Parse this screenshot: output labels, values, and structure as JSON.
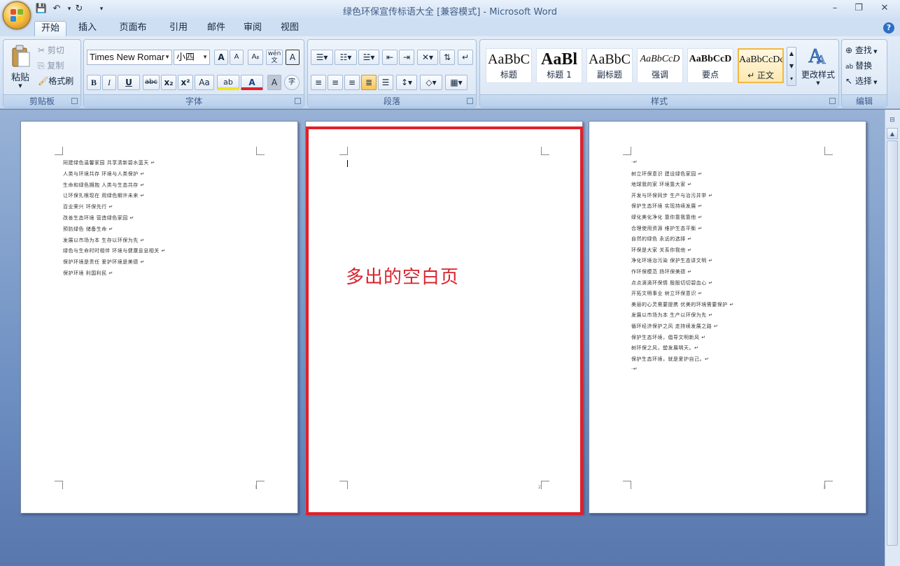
{
  "window": {
    "title": "绿色环保宣传标语大全 [兼容模式] - Microsoft Word",
    "minimize": "–",
    "restore": "❐",
    "close": "✕"
  },
  "qat": {
    "save": "💾",
    "undo": "↶",
    "redo": "↻",
    "more": "▾"
  },
  "tabs": [
    "开始",
    "插入",
    "页面布局",
    "引用",
    "邮件",
    "审阅",
    "视图"
  ],
  "active_tab": "开始",
  "help": "?",
  "clipboard": {
    "paste": "粘贴",
    "cut": "剪切",
    "copy": "复制",
    "format_painter": "格式刷",
    "label": "剪贴板"
  },
  "font": {
    "name": "Times New Romar",
    "size": "小四",
    "grow": "A",
    "shrink": "A",
    "clear": "Aᵦ",
    "phonetic": "wén\n文",
    "border_char": "A",
    "bold": "B",
    "italic": "I",
    "underline": "U",
    "strike": "abc",
    "sub": "x₂",
    "sup": "x²",
    "case": "Aa",
    "highlight": "ab",
    "color": "A",
    "shade": "A",
    "enclose": "字",
    "label": "字体"
  },
  "paragraph": {
    "label": "段落"
  },
  "styles": {
    "items": [
      {
        "preview": "AaBbC",
        "name": "标题"
      },
      {
        "preview": "AaBl",
        "name": "标题 1"
      },
      {
        "preview": "AaBbC",
        "name": "副标题"
      },
      {
        "preview": "AaBbCcD",
        "name": "强调"
      },
      {
        "preview": "AaBbCcD",
        "name": "要点"
      },
      {
        "preview": "AaBbCcDc",
        "name": "↵ 正文"
      }
    ],
    "change": "更改样式",
    "label": "样式"
  },
  "editing": {
    "find": "查找",
    "replace": "替换",
    "select": "选择",
    "label": "编辑"
  },
  "pages": {
    "left_lines": [
      "同建绿色温馨家园 共享清新碧水蓝天 ↵",
      "人类与环境共存 环境与人类保护 ↵",
      "生命和绿色拥抱 人类与生态共存 ↵",
      "让环保扎根现在 用绿色期许未来 ↵",
      "百业荣兴 环保先行 ↵",
      "改善生态环境 营造绿色家园 ↵",
      "预防绿色 储备生命 ↵",
      "发展以市场为本 生存以环保为先 ↵",
      "绿色与生命时时相伴 环境与健康息息相关 ↵",
      "保护环境是责任 爱护环境是美德 ↵",
      "保护环境 利国利民 ↵"
    ],
    "right_lines": [
      "·↵",
      "树立环保意识 建设绿色家园 ↵",
      "地球我的家 环境靠大家 ↵",
      "开发与环保同步 生产与治污并举 ↵",
      "保护生态环境 实现持续发展 ↵",
      "绿化美化净化 靠你靠我靠他 ↵",
      "合理使用资源 维护生态平衡 ↵",
      "自然的绿色 永远的选择 ↵",
      "环保是大家 关系你我他 ↵",
      "净化环境治污染 保护生态讲文明 ↵",
      "作环保模范 扬环保美德 ↵",
      "点点滴滴环保情 殷殷切切碧血心 ↵",
      "开拓文明事业 树立环保意识 ↵",
      "美丽的心灵需要提携 优美的环境需要保护 ↵",
      "发展以市场为本 生产以环保为先 ↵",
      "循环经济保护之风 走持续发展之路 ↵",
      "保护生态环境，倡导文明新风 ↵",
      "树环保之风，塑发展明天。↵",
      "保护生态环境，就是爱护自己。↵",
      "·↵"
    ],
    "left_num": "1",
    "middle_num": "2",
    "right_num": "3"
  },
  "annotation": {
    "text": "多出的空白页",
    "color": "#d9232d"
  }
}
